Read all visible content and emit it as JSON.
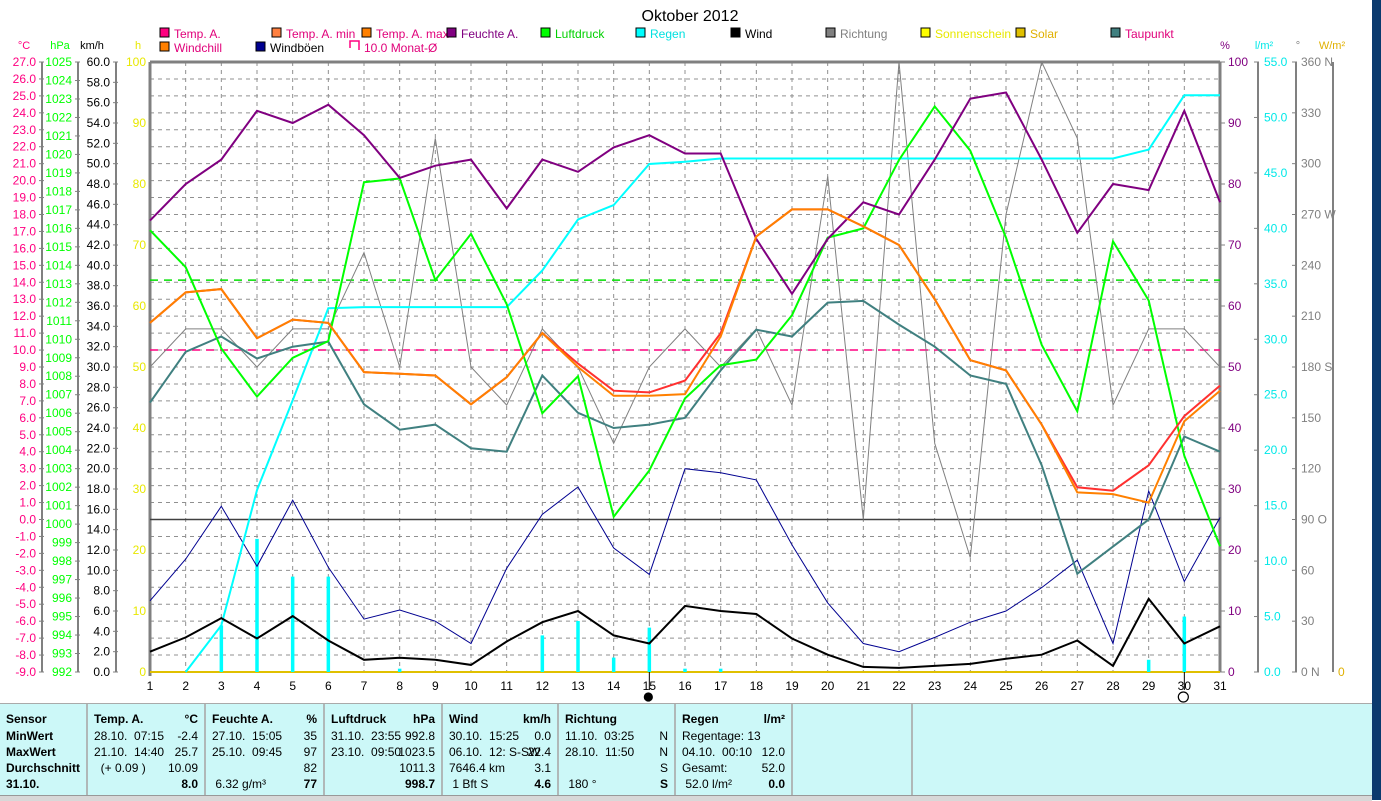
{
  "chart_data": {
    "type": "line",
    "title": "Oktober 2012",
    "x": [
      1,
      2,
      3,
      4,
      5,
      6,
      7,
      8,
      9,
      10,
      11,
      12,
      13,
      14,
      15,
      16,
      17,
      18,
      19,
      20,
      21,
      22,
      23,
      24,
      25,
      26,
      27,
      28,
      29,
      30,
      31
    ],
    "xlim": [
      1,
      31
    ],
    "grid": true,
    "legend_position": "top",
    "legend": [
      {
        "label": "Temp. A.",
        "swatch": "#ff0080",
        "text": "#e0007a"
      },
      {
        "label": "Temp. A. min",
        "swatch": "#ff8040",
        "text": "#e0007a"
      },
      {
        "label": "Temp. A. max",
        "swatch": "#ff8000",
        "text": "#e0007a"
      },
      {
        "label": "Feuchte A.",
        "swatch": "#800080",
        "text": "#800080"
      },
      {
        "label": "Luftdruck",
        "swatch": "#00ff00",
        "text": "#00d000"
      },
      {
        "label": "Regen",
        "swatch": "#00ffff",
        "text": "#00e0e0"
      },
      {
        "label": "Wind",
        "swatch": "#000000",
        "text": "#000000"
      },
      {
        "label": "Richtung",
        "swatch": "#808080",
        "text": "#808080"
      },
      {
        "label": "Sonnenschein",
        "swatch": "#ffff00",
        "text": "#e8e800"
      },
      {
        "label": "Solar",
        "swatch": "#e0c000",
        "text": "#e0b000"
      },
      {
        "label": "Taupunkt",
        "swatch": "#408080",
        "text": "#e0007a"
      },
      {
        "label": "Windchill",
        "swatch": "#ff8000",
        "text": "#e0007a"
      },
      {
        "label": "Windböen",
        "swatch": "#000090",
        "text": "#000000"
      },
      {
        "label": "10.0 Monat-Ø",
        "swatch": "none",
        "text": "#e0007a"
      }
    ],
    "axes": {
      "temp": {
        "unit": "°C",
        "range": [
          -9,
          27
        ],
        "color": "#ff0080"
      },
      "pressure": {
        "unit": "hPa",
        "range": [
          992,
          1025
        ],
        "color": "#00e000"
      },
      "wind": {
        "unit": "km/h",
        "range": [
          0,
          60
        ],
        "color": "#000000"
      },
      "sun": {
        "unit": "h",
        "range": [
          0,
          100
        ],
        "color": "#e8e800"
      },
      "humidity": {
        "unit": "%",
        "range": [
          0,
          100
        ],
        "color": "#800080"
      },
      "rain": {
        "unit": "l/m²",
        "range": [
          0,
          55
        ],
        "color": "#00e0e0"
      },
      "direction": {
        "unit": "°",
        "range": [
          0,
          360
        ],
        "color": "#808080",
        "compass": {
          "360": "N",
          "270": "W",
          "180": "S",
          "90": "O",
          "0": "N"
        }
      },
      "solar": {
        "unit": "W/m²",
        "range": [
          0,
          0
        ],
        "color": "#e0b000",
        "labels": [
          "0"
        ]
      }
    },
    "series": [
      {
        "name": "Temp. A.",
        "axis": "temp",
        "color": "#ff3030",
        "width": 2,
        "values": [
          11.6,
          13.4,
          13.6,
          10.7,
          11.8,
          11.6,
          8.7,
          8.6,
          8.5,
          6.8,
          8.4,
          11.0,
          9.2,
          7.6,
          7.5,
          8.2,
          11.0,
          16.7,
          18.3,
          18.3,
          17.3,
          16.2,
          13.0,
          9.4,
          8.8,
          5.6,
          1.9,
          1.7,
          3.2,
          6.1,
          7.9
        ]
      },
      {
        "name": "Windchill",
        "axis": "temp",
        "color": "#ff8000",
        "width": 2,
        "values": [
          11.6,
          13.4,
          13.6,
          10.7,
          11.8,
          11.6,
          8.7,
          8.6,
          8.5,
          6.8,
          8.4,
          11.0,
          9.0,
          7.3,
          7.3,
          7.4,
          10.8,
          16.7,
          18.3,
          18.3,
          17.3,
          16.2,
          13.0,
          9.4,
          8.8,
          5.6,
          1.6,
          1.5,
          1.0,
          5.8,
          7.6
        ]
      },
      {
        "name": "Taupunkt",
        "axis": "temp",
        "color": "#408080",
        "width": 2,
        "values": [
          6.9,
          9.9,
          10.8,
          9.5,
          10.2,
          10.5,
          6.8,
          5.3,
          5.6,
          4.2,
          4.0,
          8.5,
          6.3,
          5.4,
          5.6,
          6.0,
          8.8,
          11.2,
          10.8,
          12.8,
          12.9,
          11.5,
          10.2,
          8.5,
          8.0,
          3.2,
          -3.2,
          -1.6,
          0.0,
          4.9,
          4.0
        ]
      },
      {
        "name": "Feuchte A.",
        "axis": "humidity",
        "color": "#800080",
        "width": 2,
        "values": [
          74,
          80,
          84,
          92,
          90,
          93,
          88,
          81,
          83,
          84,
          76,
          84,
          82,
          86,
          88,
          85,
          85,
          71,
          62,
          71,
          77,
          75,
          84,
          94,
          95,
          84,
          72,
          80,
          79,
          92,
          77
        ]
      },
      {
        "name": "Luftdruck",
        "axis": "pressure",
        "color": "#00ff00",
        "width": 2,
        "values": [
          1015.9,
          1013.9,
          1009.5,
          1006.9,
          1009.0,
          1009.9,
          1018.5,
          1018.7,
          1013.2,
          1015.7,
          1011.9,
          1006.0,
          1008.0,
          1000.4,
          1002.9,
          1006.8,
          1008.6,
          1008.9,
          1011.3,
          1015.5,
          1016.0,
          1019.7,
          1022.6,
          1020.2,
          1015.5,
          1009.7,
          1006.1,
          1015.3,
          1012.1,
          1003.7,
          998.8
        ]
      },
      {
        "name": "Regen (Summe)",
        "axis": "rain",
        "color": "#00ffff",
        "width": 2,
        "start": 2,
        "values": [
          null,
          0.0,
          4.2,
          16.4,
          24.5,
          32.8,
          32.9,
          32.9,
          32.9,
          32.9,
          32.9,
          36.2,
          40.8,
          42.1,
          45.8,
          46.0,
          46.3,
          46.3,
          46.3,
          46.3,
          46.3,
          46.3,
          46.3,
          46.3,
          46.3,
          46.3,
          46.3,
          46.3,
          47.1,
          52.0,
          52.0
        ]
      },
      {
        "name": "Wind",
        "axis": "wind",
        "color": "#000000",
        "width": 2,
        "values": [
          2.0,
          3.4,
          5.3,
          3.3,
          5.5,
          3.1,
          1.2,
          1.4,
          1.2,
          0.7,
          3.0,
          4.9,
          6.0,
          3.6,
          2.8,
          6.5,
          6.0,
          5.7,
          3.3,
          1.7,
          0.5,
          0.4,
          0.6,
          0.8,
          1.3,
          1.7,
          3.1,
          0.6,
          7.2,
          2.8,
          4.5
        ]
      },
      {
        "name": "Windböen",
        "axis": "wind",
        "color": "#000090",
        "width": 1,
        "values": [
          7.0,
          11.1,
          16.3,
          10.4,
          16.9,
          10.3,
          5.2,
          6.1,
          5.0,
          2.8,
          10.2,
          15.5,
          18.2,
          12.2,
          9.6,
          20.0,
          19.6,
          18.9,
          12.5,
          6.8,
          2.8,
          2.0,
          3.4,
          4.9,
          6.0,
          8.3,
          11.0,
          2.8,
          17.8,
          8.9,
          15.2
        ]
      },
      {
        "name": "Richtung",
        "axis": "direction",
        "color": "#808080",
        "width": 1,
        "values": [
          180,
          202.5,
          202.5,
          180,
          202.5,
          202.5,
          247.5,
          180,
          315,
          180,
          157.5,
          202.5,
          180,
          135,
          180,
          202.5,
          180,
          202.5,
          157.5,
          292.5,
          90,
          360,
          135,
          67.5,
          270,
          360,
          315,
          157.5,
          202.5,
          202.5,
          180
        ]
      }
    ],
    "rain_daily": {
      "axis": "rain",
      "color": "#00ffff",
      "values": [
        0,
        0,
        4.2,
        12.0,
        8.6,
        8.6,
        0,
        0.3,
        0,
        0,
        0,
        3.3,
        4.6,
        1.3,
        4.0,
        0.3,
        0.3,
        0,
        0,
        0,
        0,
        0,
        0,
        0,
        0,
        0,
        0,
        0,
        1.1,
        5.0,
        0
      ]
    },
    "reference_lines": [
      {
        "name": "temp-monthly-avg",
        "axis": "temp",
        "value": 10.0,
        "color": "#ff0080",
        "dash": true
      },
      {
        "name": "pressure-avg",
        "axis": "pressure",
        "value": 1013.2,
        "color": "#00e000",
        "dash": true
      },
      {
        "name": "zero-degree",
        "axis": "temp",
        "value": 0.0,
        "color": "#404040",
        "dash": false
      }
    ],
    "moon_phases": [
      {
        "day": 15,
        "phase": "new"
      },
      {
        "day": 30,
        "phase": "full"
      }
    ]
  },
  "stats": {
    "columns": [
      {
        "header": "Sensor",
        "unit": "",
        "rows": [
          [
            "MinWert",
            ""
          ],
          [
            "MaxWert",
            ""
          ],
          [
            "Durchschnitt",
            ""
          ],
          [
            "31.10.",
            ""
          ]
        ],
        "bold_rows": [
          3
        ]
      },
      {
        "header": "Temp. A.",
        "unit": "°C",
        "rows": [
          [
            "28.10.  07:15",
            "-2.4"
          ],
          [
            "21.10.  14:40",
            "25.7"
          ],
          [
            "  (+ 0.09 )",
            "10.09"
          ],
          [
            "",
            "8.0"
          ]
        ]
      },
      {
        "header": "Feuchte A.",
        "unit": "%",
        "rows": [
          [
            "27.10.  15:05",
            "35"
          ],
          [
            "25.10.  09:45",
            "97"
          ],
          [
            "",
            "82"
          ],
          [
            " 6.32 g/m³",
            "77"
          ]
        ]
      },
      {
        "header": "Luftdruck",
        "unit": "hPa",
        "rows": [
          [
            "31.10.  23:55",
            "992.8"
          ],
          [
            "23.10.  09:50",
            "1023.5"
          ],
          [
            "",
            "1011.3"
          ],
          [
            "",
            "998.7"
          ]
        ]
      },
      {
        "header": "Wind",
        "unit": "km/h",
        "rows": [
          [
            "30.10.  15:25",
            "0.0"
          ],
          [
            "06.10.  12: S-SW",
            "22.4"
          ],
          [
            "7646.4 km",
            "3.1"
          ],
          [
            " 1 Bft S",
            "4.6"
          ]
        ]
      },
      {
        "header": "Richtung",
        "unit": "",
        "rows": [
          [
            "11.10.  03:25",
            "N"
          ],
          [
            "28.10.  11:50",
            "N"
          ],
          [
            "",
            "S"
          ],
          [
            " 180 °",
            "S"
          ]
        ]
      },
      {
        "header": "Regen",
        "unit": "l/m²",
        "rows": [
          [
            "Regentage: 13",
            ""
          ],
          [
            "04.10.  00:10",
            "12.0"
          ],
          [
            "Gesamt:",
            "52.0"
          ],
          [
            " 52.0 l/m²",
            "0.0"
          ]
        ]
      }
    ]
  }
}
